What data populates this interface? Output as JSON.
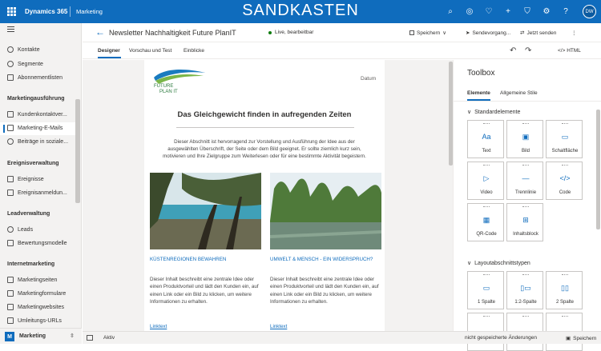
{
  "topbar": {
    "brand": "Dynamics 365",
    "app": "Marketing",
    "environment": "SANDKASTEN",
    "avatar": "DW",
    "icons": [
      "search-icon",
      "target-icon",
      "lightbulb-icon",
      "plus-icon",
      "filter-icon",
      "gear-icon",
      "help-icon"
    ]
  },
  "sidebar": {
    "items_top": [
      "Kontakte",
      "Segmente",
      "Abonnementlisten"
    ],
    "section1": "Marketingausführung",
    "items1": [
      "Kundenkontaktver...",
      "Marketing-E-Mails",
      "Beiträge in soziale..."
    ],
    "section2": "Ereignisverwaltung",
    "items2": [
      "Ereignisse",
      "Ereignisanmeldun..."
    ],
    "section3": "Leadverwaltung",
    "items3": [
      "Leads",
      "Bewertungsmodelle"
    ],
    "section4": "Internetmarketing",
    "items4": [
      "Marketingseiten",
      "Marketingformulare",
      "Marketingwebsites",
      "Umleitungs-URLs"
    ],
    "area": {
      "letter": "M",
      "label": "Marketing"
    }
  },
  "header": {
    "title": "Newsletter Nachhaltigkeit Future PlanIT",
    "status": "Live, bearbeitbar",
    "save": "Speichern",
    "send": "Sendevorgang...",
    "sendnow": "Jetzt senden",
    "more": "⋮"
  },
  "tabs": {
    "designer": "Designer",
    "preview": "Vorschau und Test",
    "insights": "Einblicke",
    "html": "HTML"
  },
  "email": {
    "logo_line1": "FUTURE",
    "logo_line2": "PLAN IT",
    "date": "Datum",
    "headline": "Das Gleichgewicht finden in aufregenden Zeiten",
    "intro": "Dieser Abschnitt ist hervorragend zur Vorstellung und Ausführung der Idee aus der ausgewählten Überschrift, der Seite oder dem Bild geeignet. Er sollte ziemlich kurz sein, motivieren und Ihre Zielgruppe zum Weiterlesen oder für eine bestimmte Aktivität begeistern.",
    "col1_title": "KÜSTENREGIONEN BEWAHREN",
    "col2_title": "UMWELT & MENSCH - EIN WIDERSPRUCH?",
    "col_text": "Dieser Inhalt beschreibt eine zentrale Idee oder einen Produktvorteil und lädt den Kunden ein, auf einen Link oder ein Bild zu klicken, um weitere Informationen zu erhalten.",
    "link": "Linktext"
  },
  "toolbox": {
    "title": "Toolbox",
    "tab_elements": "Elemente",
    "tab_styles": "Allgemeine Stile",
    "section_std": "Standardelemente",
    "elements": [
      "Text",
      "Bild",
      "Schaltfläche",
      "Video",
      "Trennlinie",
      "Code",
      "QR-Code",
      "Inhaltsblock"
    ],
    "section_layout": "Layoutabschnittstypen",
    "layouts": [
      "1 Spalte",
      "1:2-Spalte",
      "2 Spalte"
    ]
  },
  "statusbar": {
    "state": "Aktiv",
    "unsaved": "nicht gespeicherte Änderungen",
    "save": "Speichern"
  },
  "colors": {
    "brand": "#0f6cbd",
    "live": "#107c10"
  }
}
